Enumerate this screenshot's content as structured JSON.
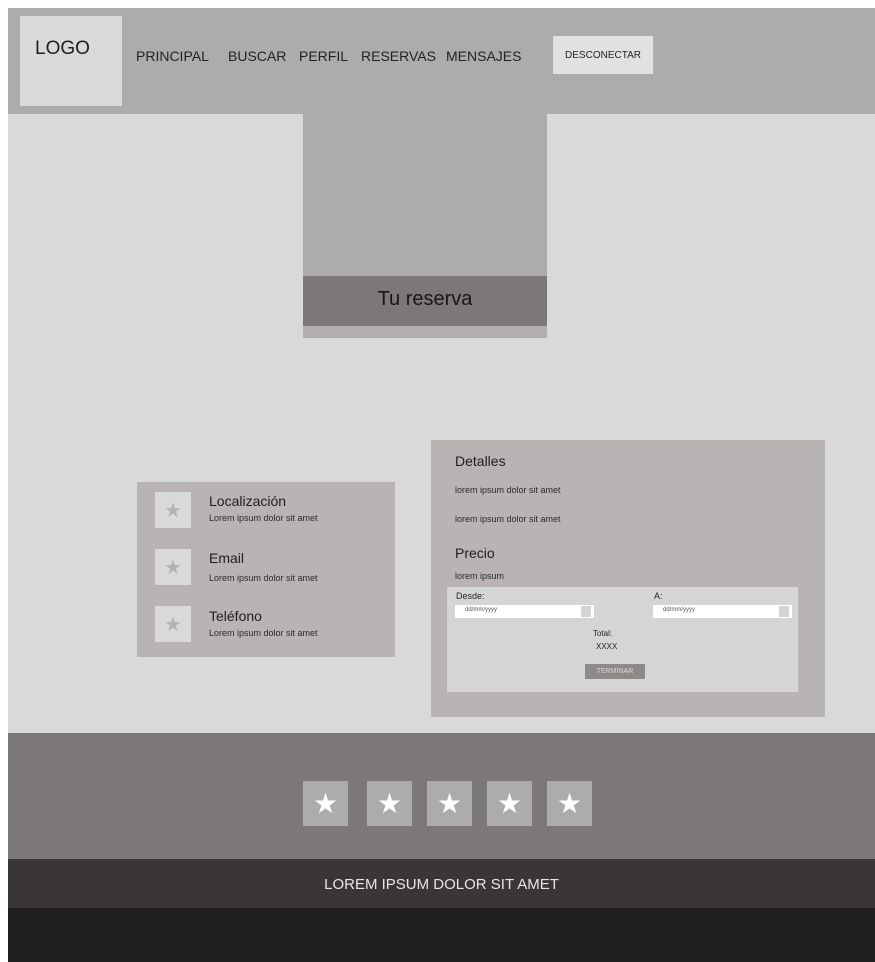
{
  "header": {
    "logo": "LOGO",
    "nav": [
      "PRINCIPAL",
      "BUSCAR",
      "PERFIL",
      "RESERVAS",
      "MENSAJES"
    ],
    "logout": "DESCONECTAR"
  },
  "hero": {
    "title": "Tu reserva"
  },
  "contact": {
    "icon": "star-icon",
    "items": [
      {
        "title": "Localización",
        "text": "Lorem ipsum dolor sit amet"
      },
      {
        "title": "Email",
        "text": "Lorem ipsum dolor sit amet"
      },
      {
        "title": "Teléfono",
        "text": "Lorem ipsum dolor sit amet"
      }
    ]
  },
  "details": {
    "heading": "Detalles",
    "lines": [
      "lorem ipsum dolor sit amet",
      "lorem ipsum dolor sit amet"
    ],
    "price_heading": "Precio",
    "price_text": "lorem ipsum",
    "booking": {
      "from_label": "Desde:",
      "to_label": "A:",
      "from_value": "dd/mm/yyyy",
      "to_value": "dd/mm/yyyy",
      "total_label": "Total:",
      "total_value": "XXXX",
      "button": "TERMINAR"
    }
  },
  "footer": {
    "rating_icon": "★",
    "text": "LOREM IPSUM DOLOR SIT AMET"
  }
}
